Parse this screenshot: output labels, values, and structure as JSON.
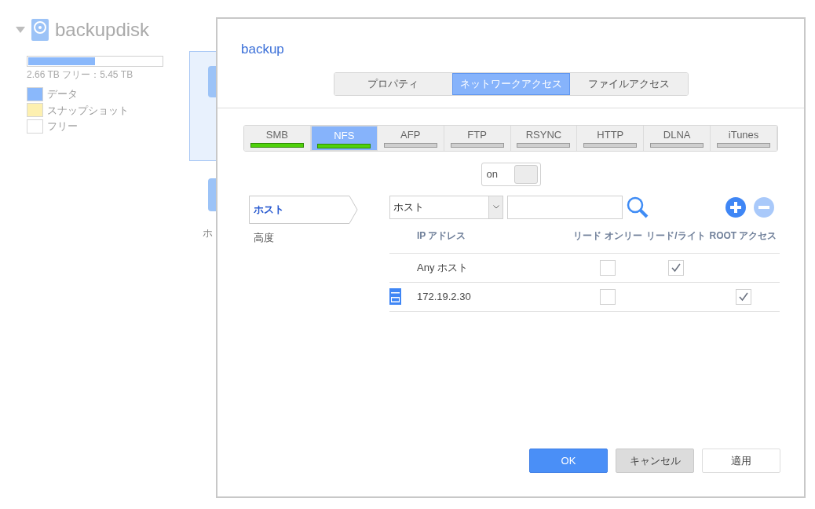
{
  "disk": {
    "name": "backupdisk",
    "usage": {
      "level": 0.5
    },
    "usage_text": "2.66 TB フリー：5.45 TB",
    "legend": [
      {
        "label": "データ",
        "color": "#8ab8fb"
      },
      {
        "label": "スナップショット",
        "color": "#fdf0b0"
      },
      {
        "label": "フリー",
        "color": "#ffffff"
      }
    ],
    "background_text": "ホ"
  },
  "dialog": {
    "title": "backup",
    "tabs": [
      {
        "label": "プロパティ",
        "selected": false
      },
      {
        "label": "ネットワークアクセス",
        "selected": true
      },
      {
        "label": "ファイルアクセス",
        "selected": false
      }
    ],
    "services": [
      {
        "label": "SMB",
        "selected": false,
        "enabled": true
      },
      {
        "label": "NFS",
        "selected": true,
        "enabled": true
      },
      {
        "label": "AFP",
        "selected": false,
        "enabled": false
      },
      {
        "label": "FTP",
        "selected": false,
        "enabled": false
      },
      {
        "label": "RSYNC",
        "selected": false,
        "enabled": false
      },
      {
        "label": "HTTP",
        "selected": false,
        "enabled": false
      },
      {
        "label": "DLNA",
        "selected": false,
        "enabled": false
      },
      {
        "label": "iTunes",
        "selected": false,
        "enabled": false
      }
    ],
    "toggle": {
      "label": "on",
      "on": true
    },
    "nav": [
      {
        "label": "ホスト",
        "selected": true
      },
      {
        "label": "高度",
        "selected": false
      }
    ],
    "filter": {
      "value": "ホスト"
    },
    "columns": [
      "IP アドレス",
      "リード オンリー",
      "リード/ライト",
      "ROOT アクセス"
    ],
    "rows": [
      {
        "kind": "any",
        "address": "Any ホスト",
        "cells": [
          {
            "kind": "checkbox",
            "checked": false
          },
          {
            "kind": "checkbox",
            "checked": true
          },
          {
            "kind": "empty"
          }
        ]
      },
      {
        "kind": "host",
        "address": "172.19.2.30",
        "cells": [
          {
            "kind": "checkbox",
            "checked": false
          },
          {
            "kind": "empty"
          },
          {
            "kind": "checkbox",
            "checked": true
          }
        ]
      }
    ],
    "buttons": [
      {
        "label": "OK",
        "kind": "primary"
      },
      {
        "label": "キャンセル",
        "kind": "secondary"
      },
      {
        "label": "適用",
        "kind": "plain"
      }
    ]
  }
}
